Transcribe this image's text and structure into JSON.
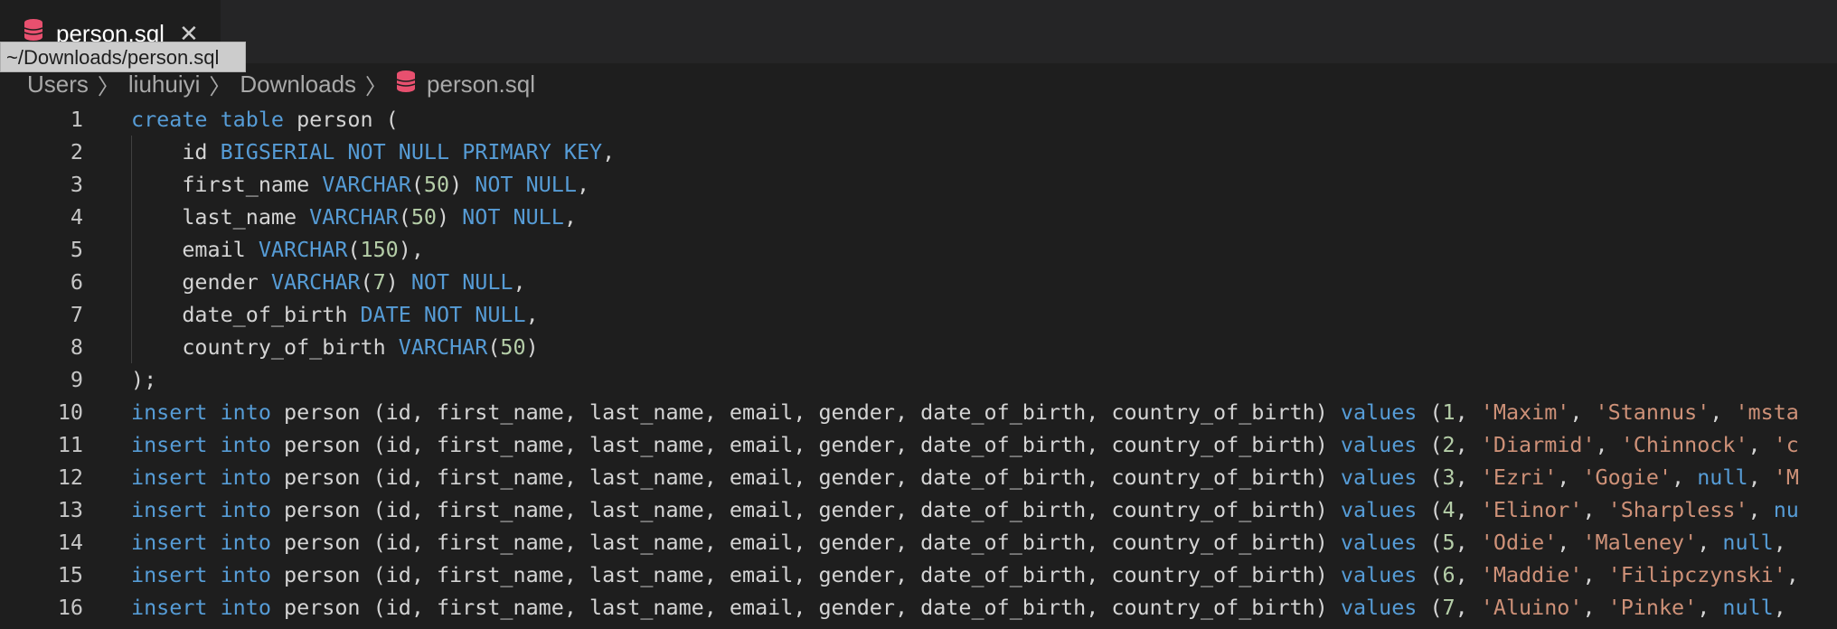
{
  "tab": {
    "label": "person.sql",
    "close_icon": "close-icon",
    "file_icon": "database-icon"
  },
  "tooltip": {
    "text": "~/Downloads/person.sql"
  },
  "breadcrumb": {
    "items": [
      "Users",
      "liuhuiyi",
      "Downloads"
    ],
    "file": "person.sql"
  },
  "colors": {
    "keyword": "#569cd6",
    "number": "#b5cea8",
    "string": "#ce9178",
    "text": "#d4d4d4",
    "icon": "#e8506f"
  },
  "editor": {
    "lines": [
      {
        "n": "1",
        "tokens": [
          [
            "kw",
            "create"
          ],
          [
            "p",
            " "
          ],
          [
            "kw",
            "table"
          ],
          [
            "p",
            " person ("
          ]
        ]
      },
      {
        "n": "2",
        "tokens": [
          [
            "p",
            "    id "
          ],
          [
            "kw",
            "BIGSERIAL"
          ],
          [
            "p",
            " "
          ],
          [
            "kw",
            "NOT"
          ],
          [
            "p",
            " "
          ],
          [
            "kw",
            "NULL"
          ],
          [
            "p",
            " "
          ],
          [
            "kw",
            "PRIMARY"
          ],
          [
            "p",
            " "
          ],
          [
            "kw",
            "KEY"
          ],
          [
            "p",
            ","
          ]
        ]
      },
      {
        "n": "3",
        "tokens": [
          [
            "p",
            "    first_name "
          ],
          [
            "kw",
            "VARCHAR"
          ],
          [
            "p",
            "("
          ],
          [
            "num",
            "50"
          ],
          [
            "p",
            ") "
          ],
          [
            "kw",
            "NOT"
          ],
          [
            "p",
            " "
          ],
          [
            "kw",
            "NULL"
          ],
          [
            "p",
            ","
          ]
        ]
      },
      {
        "n": "4",
        "tokens": [
          [
            "p",
            "    last_name "
          ],
          [
            "kw",
            "VARCHAR"
          ],
          [
            "p",
            "("
          ],
          [
            "num",
            "50"
          ],
          [
            "p",
            ") "
          ],
          [
            "kw",
            "NOT"
          ],
          [
            "p",
            " "
          ],
          [
            "kw",
            "NULL"
          ],
          [
            "p",
            ","
          ]
        ]
      },
      {
        "n": "5",
        "tokens": [
          [
            "p",
            "    email "
          ],
          [
            "kw",
            "VARCHAR"
          ],
          [
            "p",
            "("
          ],
          [
            "num",
            "150"
          ],
          [
            "p",
            "),"
          ]
        ]
      },
      {
        "n": "6",
        "tokens": [
          [
            "p",
            "    gender "
          ],
          [
            "kw",
            "VARCHAR"
          ],
          [
            "p",
            "("
          ],
          [
            "num",
            "7"
          ],
          [
            "p",
            ") "
          ],
          [
            "kw",
            "NOT"
          ],
          [
            "p",
            " "
          ],
          [
            "kw",
            "NULL"
          ],
          [
            "p",
            ","
          ]
        ]
      },
      {
        "n": "7",
        "tokens": [
          [
            "p",
            "    date_of_birth "
          ],
          [
            "kw",
            "DATE"
          ],
          [
            "p",
            " "
          ],
          [
            "kw",
            "NOT"
          ],
          [
            "p",
            " "
          ],
          [
            "kw",
            "NULL"
          ],
          [
            "p",
            ","
          ]
        ]
      },
      {
        "n": "8",
        "tokens": [
          [
            "p",
            "    country_of_birth "
          ],
          [
            "kw",
            "VARCHAR"
          ],
          [
            "p",
            "("
          ],
          [
            "num",
            "50"
          ],
          [
            "p",
            ")"
          ]
        ]
      },
      {
        "n": "9",
        "tokens": [
          [
            "p",
            ");"
          ]
        ]
      },
      {
        "n": "10",
        "tokens": [
          [
            "kw",
            "insert"
          ],
          [
            "p",
            " "
          ],
          [
            "kw",
            "into"
          ],
          [
            "p",
            " person (id, first_name, last_name, email, gender, date_of_birth, country_of_birth) "
          ],
          [
            "kw",
            "values"
          ],
          [
            "p",
            " ("
          ],
          [
            "num",
            "1"
          ],
          [
            "p",
            ", "
          ],
          [
            "str",
            "'Maxim'"
          ],
          [
            "p",
            ", "
          ],
          [
            "str",
            "'Stannus'"
          ],
          [
            "p",
            ", "
          ],
          [
            "str",
            "'msta"
          ]
        ]
      },
      {
        "n": "11",
        "tokens": [
          [
            "kw",
            "insert"
          ],
          [
            "p",
            " "
          ],
          [
            "kw",
            "into"
          ],
          [
            "p",
            " person (id, first_name, last_name, email, gender, date_of_birth, country_of_birth) "
          ],
          [
            "kw",
            "values"
          ],
          [
            "p",
            " ("
          ],
          [
            "num",
            "2"
          ],
          [
            "p",
            ", "
          ],
          [
            "str",
            "'Diarmid'"
          ],
          [
            "p",
            ", "
          ],
          [
            "str",
            "'Chinnock'"
          ],
          [
            "p",
            ", "
          ],
          [
            "str",
            "'c"
          ]
        ]
      },
      {
        "n": "12",
        "tokens": [
          [
            "kw",
            "insert"
          ],
          [
            "p",
            " "
          ],
          [
            "kw",
            "into"
          ],
          [
            "p",
            " person (id, first_name, last_name, email, gender, date_of_birth, country_of_birth) "
          ],
          [
            "kw",
            "values"
          ],
          [
            "p",
            " ("
          ],
          [
            "num",
            "3"
          ],
          [
            "p",
            ", "
          ],
          [
            "str",
            "'Ezri'"
          ],
          [
            "p",
            ", "
          ],
          [
            "str",
            "'Gogie'"
          ],
          [
            "p",
            ", "
          ],
          [
            "kw",
            "null"
          ],
          [
            "p",
            ", "
          ],
          [
            "str",
            "'M"
          ]
        ]
      },
      {
        "n": "13",
        "tokens": [
          [
            "kw",
            "insert"
          ],
          [
            "p",
            " "
          ],
          [
            "kw",
            "into"
          ],
          [
            "p",
            " person (id, first_name, last_name, email, gender, date_of_birth, country_of_birth) "
          ],
          [
            "kw",
            "values"
          ],
          [
            "p",
            " ("
          ],
          [
            "num",
            "4"
          ],
          [
            "p",
            ", "
          ],
          [
            "str",
            "'Elinor'"
          ],
          [
            "p",
            ", "
          ],
          [
            "str",
            "'Sharpless'"
          ],
          [
            "p",
            ", "
          ],
          [
            "kw",
            "nu"
          ]
        ]
      },
      {
        "n": "14",
        "tokens": [
          [
            "kw",
            "insert"
          ],
          [
            "p",
            " "
          ],
          [
            "kw",
            "into"
          ],
          [
            "p",
            " person (id, first_name, last_name, email, gender, date_of_birth, country_of_birth) "
          ],
          [
            "kw",
            "values"
          ],
          [
            "p",
            " ("
          ],
          [
            "num",
            "5"
          ],
          [
            "p",
            ", "
          ],
          [
            "str",
            "'Odie'"
          ],
          [
            "p",
            ", "
          ],
          [
            "str",
            "'Maleney'"
          ],
          [
            "p",
            ", "
          ],
          [
            "kw",
            "null"
          ],
          [
            "p",
            ", "
          ]
        ]
      },
      {
        "n": "15",
        "tokens": [
          [
            "kw",
            "insert"
          ],
          [
            "p",
            " "
          ],
          [
            "kw",
            "into"
          ],
          [
            "p",
            " person (id, first_name, last_name, email, gender, date_of_birth, country_of_birth) "
          ],
          [
            "kw",
            "values"
          ],
          [
            "p",
            " ("
          ],
          [
            "num",
            "6"
          ],
          [
            "p",
            ", "
          ],
          [
            "str",
            "'Maddie'"
          ],
          [
            "p",
            ", "
          ],
          [
            "str",
            "'Filipczynski'"
          ],
          [
            "p",
            ","
          ]
        ]
      },
      {
        "n": "16",
        "tokens": [
          [
            "kw",
            "insert"
          ],
          [
            "p",
            " "
          ],
          [
            "kw",
            "into"
          ],
          [
            "p",
            " person (id, first_name, last_name, email, gender, date_of_birth, country_of_birth) "
          ],
          [
            "kw",
            "values"
          ],
          [
            "p",
            " ("
          ],
          [
            "num",
            "7"
          ],
          [
            "p",
            ", "
          ],
          [
            "str",
            "'Aluino'"
          ],
          [
            "p",
            ", "
          ],
          [
            "str",
            "'Pinke'"
          ],
          [
            "p",
            ", "
          ],
          [
            "kw",
            "null"
          ],
          [
            "p",
            ", "
          ]
        ]
      }
    ]
  }
}
